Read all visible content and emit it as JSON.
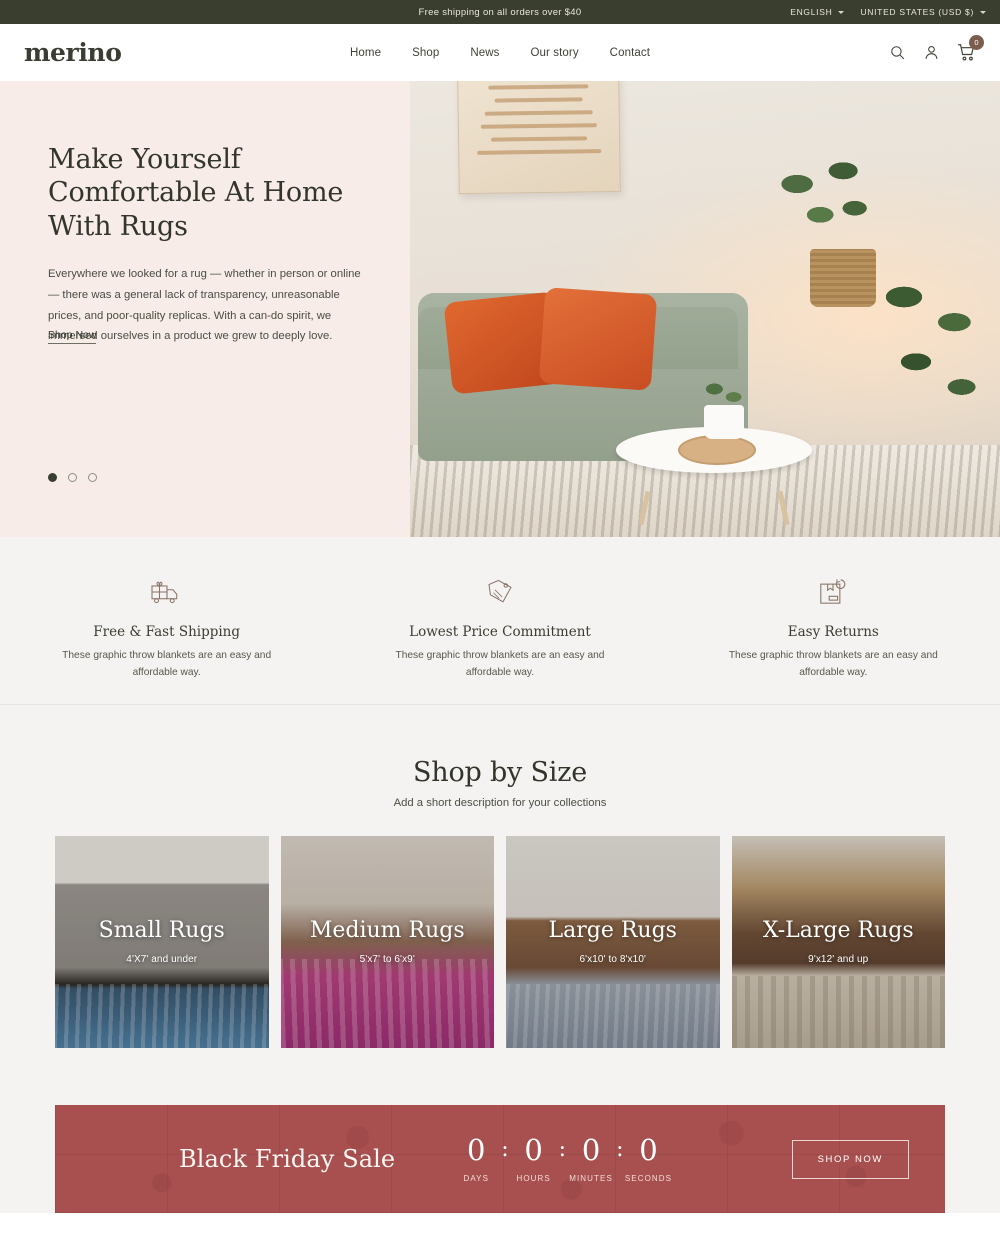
{
  "announcement": {
    "message": "Free shipping on all orders over $40",
    "language": "ENGLISH",
    "country": "UNITED STATES (USD $)"
  },
  "header": {
    "logo": "merino",
    "nav": [
      {
        "label": "Home"
      },
      {
        "label": "Shop"
      },
      {
        "label": "News"
      },
      {
        "label": "Our story"
      },
      {
        "label": "Contact"
      }
    ],
    "cart_count": "0"
  },
  "hero": {
    "title": "Make Yourself Comfortable At Home With Rugs",
    "body": "Everywhere we looked for a rug — whether in person or online — there was a general lack of transparency, unreasonable prices, and poor-quality replicas. With a can-do spirit, we immersed ourselves in a product we grew to deeply love.",
    "cta": "Shop Now",
    "slide_count": 3,
    "active_slide": 1,
    "background": "#f7ece8"
  },
  "features": [
    {
      "icon": "delivery-truck-icon",
      "title": "Free & Fast Shipping",
      "description": "These graphic throw blankets are an easy and affordable way."
    },
    {
      "icon": "price-tag-icon",
      "title": "Lowest Price Commitment",
      "description": "These graphic throw blankets are an easy and affordable way."
    },
    {
      "icon": "return-box-icon",
      "title": "Easy Returns",
      "description": "These graphic throw blankets are an easy and affordable way."
    }
  ],
  "shop_by_size": {
    "title": "Shop by Size",
    "subtitle": "Add a short description for your collections",
    "cards": [
      {
        "name": "Small Rugs",
        "dimensions": "4'X7' and under"
      },
      {
        "name": "Medium Rugs",
        "dimensions": "5'x7' to 6'x9'"
      },
      {
        "name": "Large Rugs",
        "dimensions": "6'x10' to 8'x10'"
      },
      {
        "name": "X-Large Rugs",
        "dimensions": "9'x12' and up"
      }
    ]
  },
  "promo_banner": {
    "title": "Black Friday Sale",
    "background": "#a8504f",
    "countdown": [
      {
        "value": "0",
        "label": "DAYS"
      },
      {
        "value": "0",
        "label": "HOURS"
      },
      {
        "value": "0",
        "label": "MINUTES"
      },
      {
        "value": "0",
        "label": "SECONDS"
      }
    ],
    "separator": ":",
    "button": "SHOP NOW"
  }
}
